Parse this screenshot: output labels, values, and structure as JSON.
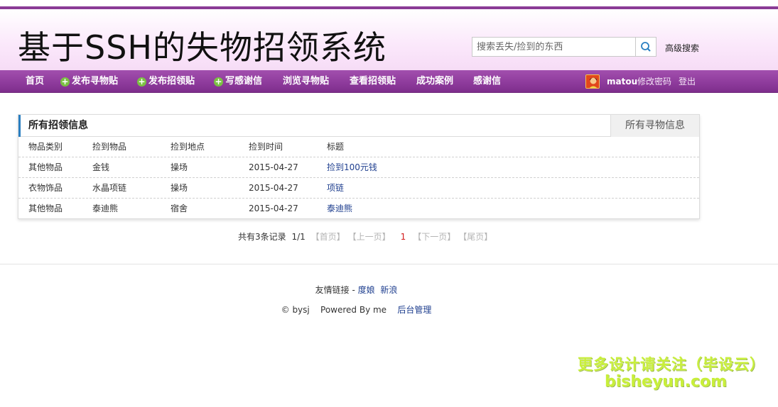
{
  "header": {
    "site_title": "基于SSH的失物招领系统",
    "search_placeholder": "搜索丢失/捡到的东西",
    "advanced_search": "高级搜索"
  },
  "nav": {
    "items": [
      {
        "label": "首页",
        "plus": false
      },
      {
        "label": "发布寻物贴",
        "plus": true
      },
      {
        "label": "发布招领贴",
        "plus": true
      },
      {
        "label": "写感谢信",
        "plus": true
      },
      {
        "label": "浏览寻物贴",
        "plus": false
      },
      {
        "label": "查看招领贴",
        "plus": false
      },
      {
        "label": "成功案例",
        "plus": false
      },
      {
        "label": "感谢信",
        "plus": false
      }
    ],
    "username": "matou",
    "change_password": "修改密码",
    "logout": "登出"
  },
  "panel": {
    "title": "所有招领信息",
    "other_tab": "所有寻物信息",
    "columns": [
      "物品类别",
      "捡到物品",
      "捡到地点",
      "捡到时间",
      "标题"
    ],
    "rows": [
      [
        "其他物品",
        "金钱",
        "操场",
        "2015-04-27",
        "捡到100元钱"
      ],
      [
        "衣物饰品",
        "水晶项链",
        "操场",
        "2015-04-27",
        "项链"
      ],
      [
        "其他物品",
        "泰迪熊",
        "宿舍",
        "2015-04-27",
        "泰迪熊"
      ]
    ]
  },
  "pager": {
    "total": "共有3条记录",
    "page": "1/1",
    "first": "【首页】",
    "prev": "【上一页】",
    "current": "1",
    "next": "【下一页】",
    "last": "【尾页】"
  },
  "footer": {
    "friend_label": "友情链接 -",
    "links": [
      "度娘",
      "新浪"
    ],
    "copyright": "© bysj",
    "powered": "Powered By me",
    "admin": "后台管理"
  },
  "watermark": {
    "line1": "更多设计请关注（毕设云）",
    "line2": "bisheyun.com"
  }
}
